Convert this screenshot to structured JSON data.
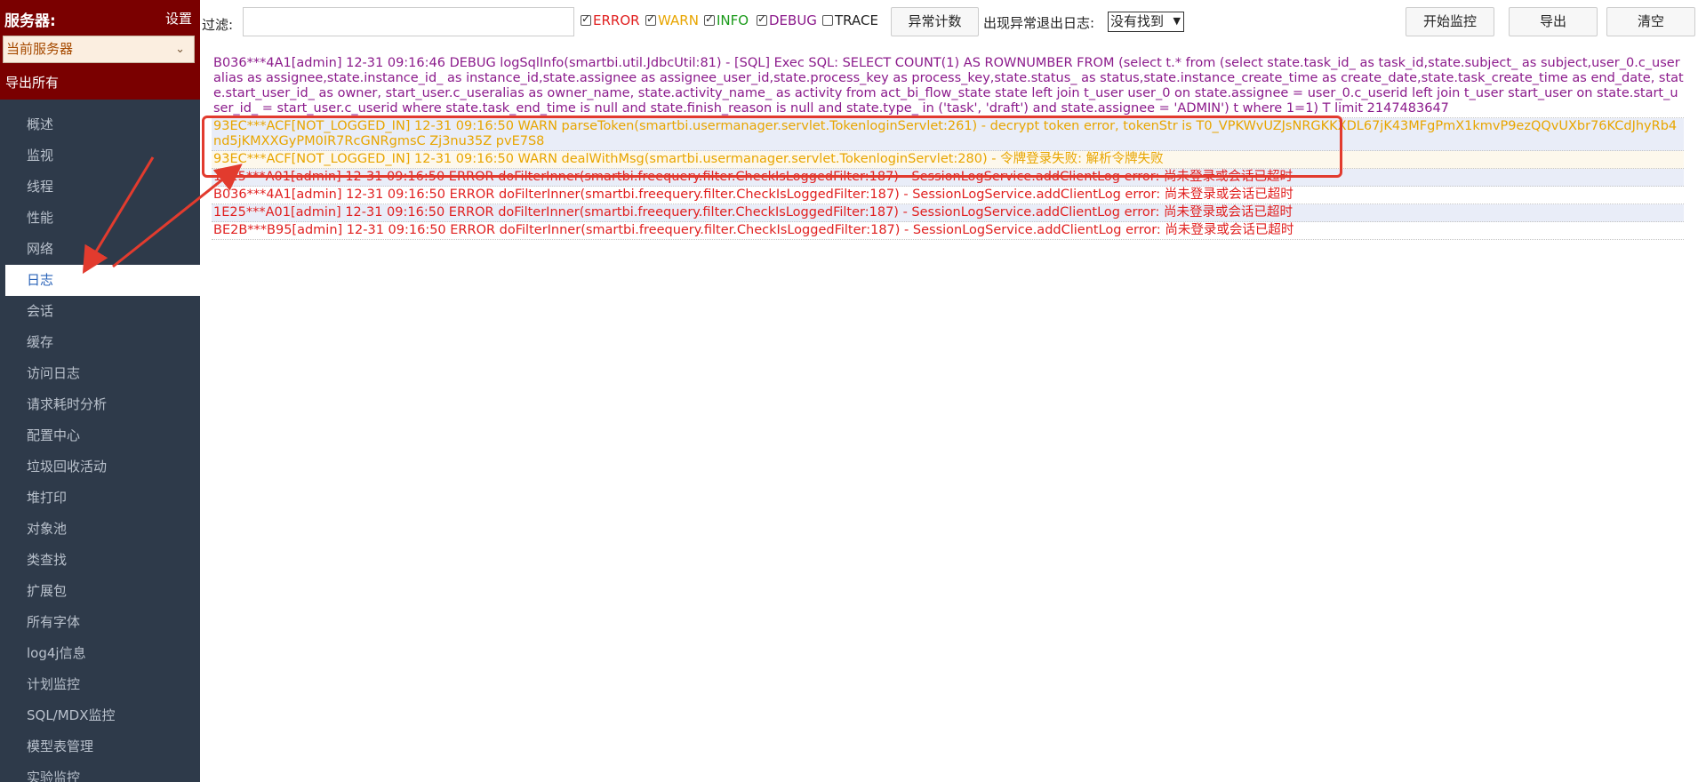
{
  "sidebar": {
    "title": "服务器:",
    "settings": "设置",
    "server_select": "当前服务器",
    "export_all": "导出所有",
    "items": [
      {
        "label": "概述"
      },
      {
        "label": "监视"
      },
      {
        "label": "线程"
      },
      {
        "label": "性能"
      },
      {
        "label": "网络"
      },
      {
        "label": "日志",
        "active": true
      },
      {
        "label": "会话"
      },
      {
        "label": "缓存"
      },
      {
        "label": "访问日志"
      },
      {
        "label": "请求耗时分析"
      },
      {
        "label": "配置中心"
      },
      {
        "label": "垃圾回收活动"
      },
      {
        "label": "堆打印"
      },
      {
        "label": "对象池"
      },
      {
        "label": "类查找"
      },
      {
        "label": "扩展包"
      },
      {
        "label": "所有字体"
      },
      {
        "label": "log4j信息"
      },
      {
        "label": "计划监控"
      },
      {
        "label": "SQL/MDX监控"
      },
      {
        "label": "模型表管理"
      },
      {
        "label": "实验监控"
      }
    ]
  },
  "toolbar": {
    "filter_label": "过滤:",
    "filter_value": "",
    "levels": {
      "error": {
        "label": "ERROR",
        "checked": true,
        "color": "#e02020"
      },
      "warn": {
        "label": "WARN",
        "checked": true,
        "color": "#e8a500"
      },
      "info": {
        "label": "INFO",
        "checked": true,
        "color": "#1a9a1a"
      },
      "debug": {
        "label": "DEBUG",
        "checked": true,
        "color": "#8b1a8b"
      },
      "trace": {
        "label": "TRACE",
        "checked": false,
        "color": "#222222"
      }
    },
    "exception_count": "异常计数",
    "exit_label": "出现异常退出日志:",
    "exit_select": "没有找到",
    "start_monitor": "开始监控",
    "export": "导出",
    "clear": "清空"
  },
  "log": {
    "lines": [
      {
        "level": "debug",
        "text": "B036***4A1[admin] 12-31 09:16:46 DEBUG logSqlInfo(smartbi.util.JdbcUtil:81) - [SQL] Exec SQL: SELECT COUNT(1) AS ROWNUMBER FROM (select t.* from (select state.task_id_ as task_id,state.subject_ as subject,user_0.c_useralias as assignee,state.instance_id_ as instance_id,state.assignee as assignee_user_id,state.process_key as process_key,state.status_ as status,state.instance_create_time as create_date,state.task_create_time as end_date, state.start_user_id_ as owner, start_user.c_useralias as owner_name, state.activity_name_ as activity from act_bi_flow_state state left join t_user user_0 on state.assignee = user_0.c_userid left join t_user start_user on state.start_user_id_ = start_user.c_userid where state.task_end_time is null and state.finish_reason is null and state.type_ in ('task', 'draft') and state.assignee = 'ADMIN') t where 1=1) T limit 2147483647"
      },
      {
        "level": "warn",
        "text": "93EC***ACF[NOT_LOGGED_IN] 12-31 09:16:50 WARN parseToken(smartbi.usermanager.servlet.TokenloginServlet:261) - decrypt token error, tokenStr is T0_VPKWvUZJsNRGKKXDL67jK43MFgPmX1kmvP9ezQQvUXbr76KCdJhyRb4nd5jKMXXGyPM0IR7RcGNRgmsC Zj3nu35Z pvE7S8"
      },
      {
        "level": "warn",
        "alt": true,
        "text": "93EC***ACF[NOT_LOGGED_IN] 12-31 09:16:50 WARN dealWithMsg(smartbi.usermanager.servlet.TokenloginServlet:280) - 令牌登录失败: 解析令牌失败"
      },
      {
        "level": "error",
        "alt": true,
        "text": "1E25***A01[admin] 12-31 09:16:50 ERROR doFilterInner(smartbi.freequery.filter.CheckIsLoggedFilter:187) - SessionLogService.addClientLog error: 尚未登录或会话已超时"
      },
      {
        "level": "error",
        "text": "B036***4A1[admin] 12-31 09:16:50 ERROR doFilterInner(smartbi.freequery.filter.CheckIsLoggedFilter:187) - SessionLogService.addClientLog error: 尚未登录或会话已超时"
      },
      {
        "level": "error",
        "alt": true,
        "text": "1E25***A01[admin] 12-31 09:16:50 ERROR doFilterInner(smartbi.freequery.filter.CheckIsLoggedFilter:187) - SessionLogService.addClientLog error: 尚未登录或会话已超时"
      },
      {
        "level": "error",
        "text": "BE2B***B95[admin] 12-31 09:16:50 ERROR doFilterInner(smartbi.freequery.filter.CheckIsLoggedFilter:187) - SessionLogService.addClientLog error: 尚未登录或会话已超时"
      }
    ]
  },
  "annotation": {
    "color": "#e23b2e"
  }
}
